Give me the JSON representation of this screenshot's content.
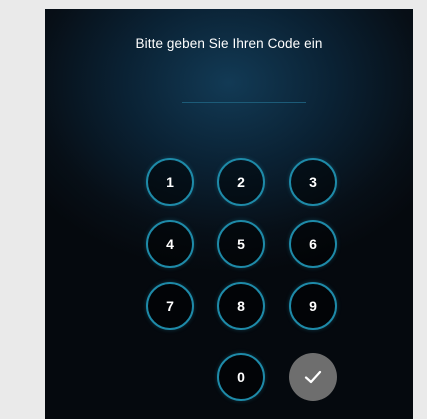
{
  "prompt": "Bitte geben Sie Ihren Code ein",
  "keys": {
    "k1": "1",
    "k2": "2",
    "k3": "3",
    "k4": "4",
    "k5": "5",
    "k6": "6",
    "k7": "7",
    "k8": "8",
    "k9": "9",
    "k0": "0"
  },
  "confirm_icon": "checkmark-icon",
  "colors": {
    "accent_ring": "#1e8aa8",
    "confirm_button": "#6e6e6e",
    "background_edge": "#eaeaea"
  }
}
